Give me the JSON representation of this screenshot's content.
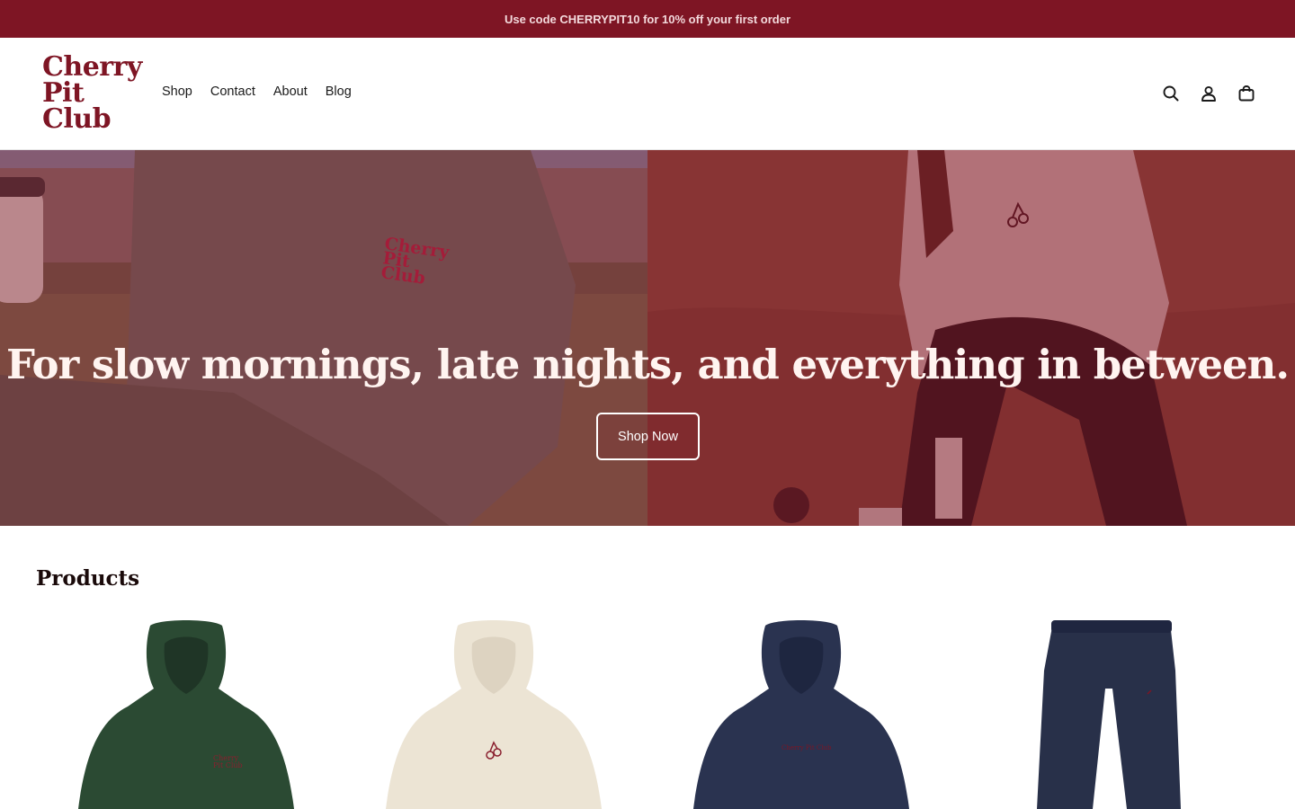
{
  "announcement": {
    "text": "Use code CHERRYPIT10 for 10% off your first order"
  },
  "brand": {
    "logo_lines": [
      "Cherry",
      "Pit",
      "Club"
    ],
    "accent": "#7e1524"
  },
  "nav": {
    "items": [
      "Shop",
      "Contact",
      "About",
      "Blog"
    ]
  },
  "header_icons": [
    "search-icon",
    "account-icon",
    "cart-icon"
  ],
  "hero": {
    "heading": "For slow mornings, late nights, and everything in between.",
    "button_label": "Shop Now",
    "sweatshirt_embroidery": [
      "Cherry",
      "Pit",
      "Club"
    ]
  },
  "products": {
    "title": "Products",
    "items": [
      {
        "kind": "hoodie",
        "color": "#2b4a33"
      },
      {
        "kind": "hoodie",
        "color": "#ece4d4"
      },
      {
        "kind": "hoodie",
        "color": "#2a3350"
      },
      {
        "kind": "sweatpants",
        "color": "#283049"
      }
    ]
  }
}
